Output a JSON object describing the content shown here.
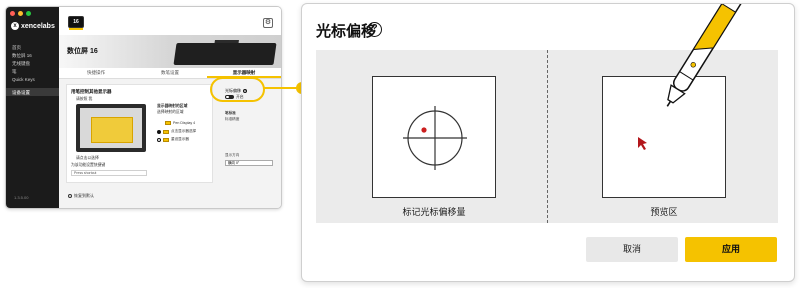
{
  "app": {
    "brand": "xencelabs",
    "version": "1.3.5.00",
    "device_badge": "16",
    "device_title": "数位屏 16",
    "sidebar_items": [
      "首页",
      "数位屏 16",
      "无线键盘",
      "笔",
      "Quick Keys"
    ],
    "settings_item": "设备设置",
    "tabs": [
      "快捷操作",
      "数笔设置",
      "显示器映射"
    ],
    "panel_title": "用笔控制其他显示器",
    "mini_label_map": "请按照 我",
    "opt_heading": "显示器映射的区域",
    "opt_sub": "选择映射的区域",
    "opt_rows": [
      "Pen Display 4",
      "点击显示器选择",
      "重设显示器"
    ],
    "shortcut_label": "为该功能设置快捷键",
    "shortcut_value": "Press shortcut",
    "monitor_caption": "请点击以选择",
    "reset_label": "恢复到默认",
    "offset_label": "光标偏移",
    "offset_toggle_text": "开启",
    "pen_label": "笔标准",
    "pen_sub": "标准精度",
    "orientation_label": "显示方向",
    "orientation_value": "横向 0°"
  },
  "dialog": {
    "title": "光标偏移",
    "help_icon": "help-circle-icon",
    "caption_left": "标记光标偏移量",
    "caption_right": "预览区",
    "cancel": "取消",
    "apply": "应用"
  },
  "colors": {
    "accent": "#f5c200",
    "marker": "#cc1f1f",
    "sidebar_bg": "#1b1b1b"
  }
}
